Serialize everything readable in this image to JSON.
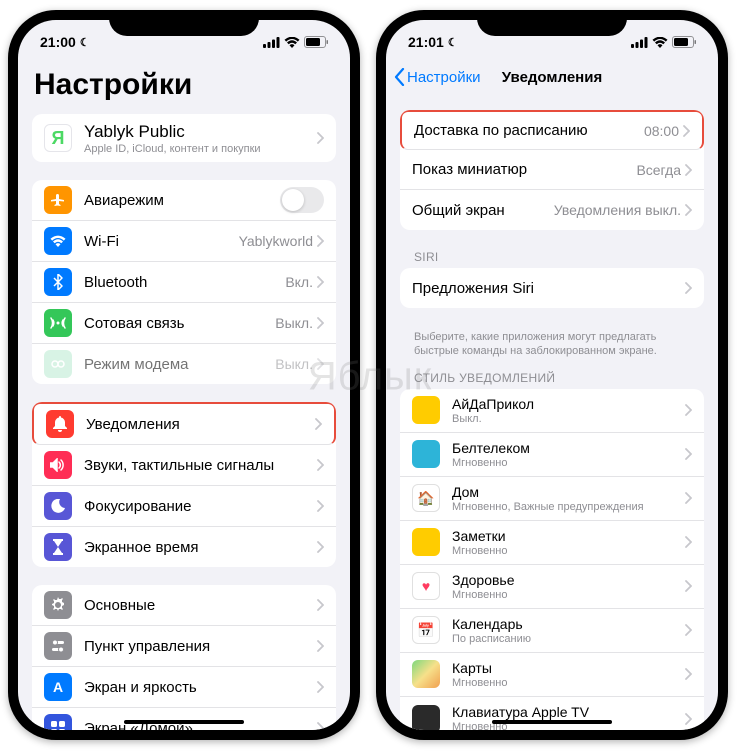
{
  "watermark": "Яблык",
  "status": {
    "time_left": "21:00",
    "time_right": "21:01"
  },
  "left": {
    "title": "Настройки",
    "account": {
      "name": "Yablyk Public",
      "sub": "Apple ID, iCloud, контент и покупки"
    },
    "g1": [
      {
        "icon": "airplane-icon",
        "bg": "#ff9500",
        "glyph": "✈",
        "label": "Авиарежим",
        "type": "toggle"
      },
      {
        "icon": "wifi-icon",
        "bg": "#007aff",
        "glyph": "",
        "label": "Wi-Fi",
        "value": "Yablykworld"
      },
      {
        "icon": "bluetooth-icon",
        "bg": "#007aff",
        "glyph": "",
        "label": "Bluetooth",
        "value": "Вкл."
      },
      {
        "icon": "cellular-icon",
        "bg": "#34c759",
        "glyph": "",
        "label": "Сотовая связь",
        "value": "Выкл."
      },
      {
        "icon": "hotspot-icon",
        "bg": "#b8ead0",
        "glyph": "",
        "label": "Режим модема",
        "value": "Выкл.",
        "disabled": true
      }
    ],
    "g2": [
      {
        "icon": "notifications-icon",
        "bg": "#ff3b30",
        "glyph": "",
        "label": "Уведомления",
        "highlight": true
      },
      {
        "icon": "sounds-icon",
        "bg": "#ff2d55",
        "glyph": "",
        "label": "Звуки, тактильные сигналы"
      },
      {
        "icon": "focus-icon",
        "bg": "#5856d6",
        "glyph": "",
        "label": "Фокусирование"
      },
      {
        "icon": "screentime-icon",
        "bg": "#5856d6",
        "glyph": "",
        "label": "Экранное время"
      }
    ],
    "g3": [
      {
        "icon": "general-icon",
        "bg": "#8e8e93",
        "glyph": "",
        "label": "Основные"
      },
      {
        "icon": "control-center-icon",
        "bg": "#8e8e93",
        "glyph": "",
        "label": "Пункт управления"
      },
      {
        "icon": "display-icon",
        "bg": "#007aff",
        "glyph": "",
        "label": "Экран и яркость"
      },
      {
        "icon": "home-screen-icon",
        "bg": "#3355dd",
        "glyph": "",
        "label": "Экран «Домой»"
      }
    ]
  },
  "right": {
    "back": "Настройки",
    "title": "Уведомления",
    "g1": [
      {
        "label": "Доставка по расписанию",
        "value": "08:00",
        "highlight": true
      },
      {
        "label": "Показ миниатюр",
        "value": "Всегда"
      },
      {
        "label": "Общий экран",
        "value": "Уведомления выкл."
      }
    ],
    "siri_header": "SIRI",
    "siri_item": {
      "label": "Предложения Siri"
    },
    "siri_footer": "Выберите, какие приложения могут предлагать быстрые команды на заблокированном экране.",
    "style_header": "СТИЛЬ УВЕДОМЛЕНИЙ",
    "apps": [
      {
        "bg": "#ffcc00",
        "name": "АйДаПрикол",
        "sub": "Выкл."
      },
      {
        "bg": "#2db4d8",
        "name": "Белтелеком",
        "sub": "Мгновенно"
      },
      {
        "bg": "#ffffff",
        "border": true,
        "glyph": "🏠",
        "gc": "#ff9500",
        "name": "Дом",
        "sub": "Мгновенно, Важные предупреждения"
      },
      {
        "bg": "#ffcc00",
        "name": "Заметки",
        "sub": "Мгновенно"
      },
      {
        "bg": "#ffffff",
        "border": true,
        "glyph": "♥",
        "gc": "#ff3b60",
        "name": "Здоровье",
        "sub": "Мгновенно"
      },
      {
        "bg": "#ffffff",
        "border": true,
        "glyph": "📅",
        "gc": "#ff3b30",
        "name": "Календарь",
        "sub": "По расписанию"
      },
      {
        "bg": "linear-gradient(135deg,#7dd87d,#f7e08a,#f0a050)",
        "name": "Карты",
        "sub": "Мгновенно"
      },
      {
        "bg": "#2a2a2a",
        "name": "Клавиатура Apple TV",
        "sub": "Мгновенно"
      }
    ]
  }
}
